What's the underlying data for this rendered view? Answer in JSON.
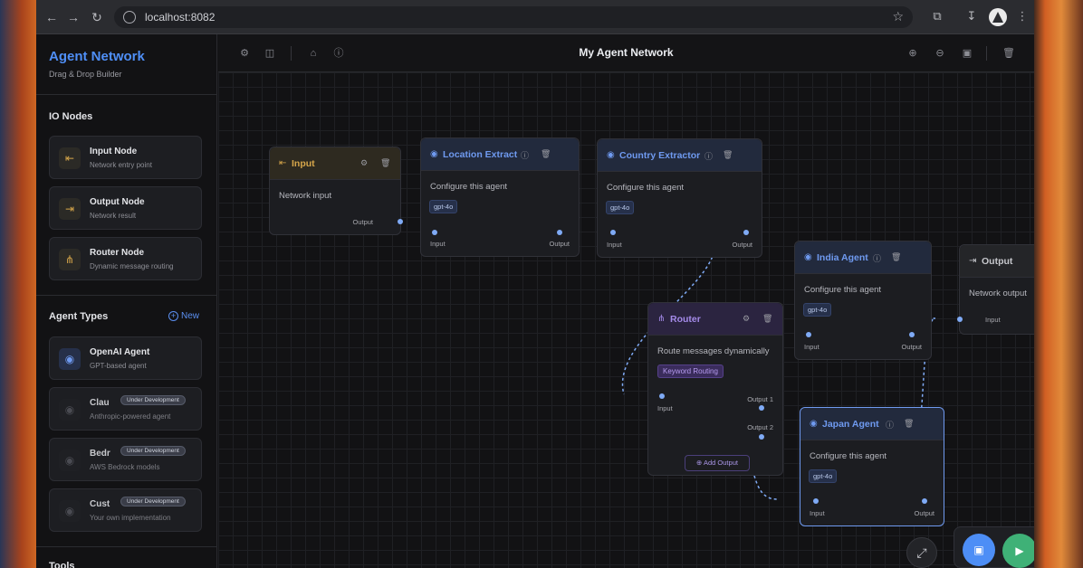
{
  "browser": {
    "url": "localhost:8082",
    "back_icon": "arrow-left-icon",
    "forward_icon": "arrow-right-icon",
    "reload_icon": "reload-icon"
  },
  "sidebar": {
    "title": "Agent Network",
    "subtitle": "Drag & Drop Builder",
    "io_section": "IO Nodes",
    "io_nodes": [
      {
        "title": "Input Node",
        "desc": "Network entry point",
        "icon": "input-icon",
        "color": "#d6a64a"
      },
      {
        "title": "Output Node",
        "desc": "Network result",
        "icon": "output-icon",
        "color": "#d6a64a"
      },
      {
        "title": "Router Node",
        "desc": "Dynamic message routing",
        "icon": "router-icon",
        "color": "#d6a64a"
      }
    ],
    "agent_section": "Agent Types",
    "new_label": "New",
    "agents": [
      {
        "title": "OpenAI Agent",
        "desc": "GPT-based agent",
        "badge": ""
      },
      {
        "title": "Clau",
        "desc": "Anthropic-powered agent",
        "badge": "Under Development"
      },
      {
        "title": "Bedr",
        "desc": "AWS Bedrock models",
        "badge": "Under Development"
      },
      {
        "title": "Cust",
        "desc": "Your own implementation",
        "badge": "Under Development"
      }
    ],
    "tools_section": "Tools"
  },
  "canvas": {
    "title": "My Agent Network",
    "nodes": {
      "input": {
        "title": "Input",
        "body": "Network input",
        "out": "Output"
      },
      "location": {
        "title": "Location Extract",
        "body": "Configure this agent",
        "chip": "gpt-4o",
        "in": "Input",
        "out": "Output"
      },
      "country": {
        "title": "Country Extractor",
        "body": "Configure this agent",
        "chip": "gpt-4o",
        "in": "Input",
        "out": "Output"
      },
      "router": {
        "title": "Router",
        "body": "Route messages dynamically",
        "chip": "Keyword Routing",
        "in": "Input",
        "out1": "Output 1",
        "out2": "Output 2",
        "add": "Add Output"
      },
      "india": {
        "title": "India Agent",
        "body": "Configure this agent",
        "chip": "gpt-4o",
        "in": "Input",
        "out": "Output"
      },
      "japan": {
        "title": "Japan Agent",
        "body": "Configure this agent",
        "chip": "gpt-4o",
        "in": "Input",
        "out": "Output"
      },
      "output": {
        "title": "Output",
        "body": "Network output",
        "in": "Input"
      }
    }
  },
  "colors": {
    "accent": "#4f8ff7",
    "wire": "#7faaf5",
    "run": "#3fb177"
  }
}
